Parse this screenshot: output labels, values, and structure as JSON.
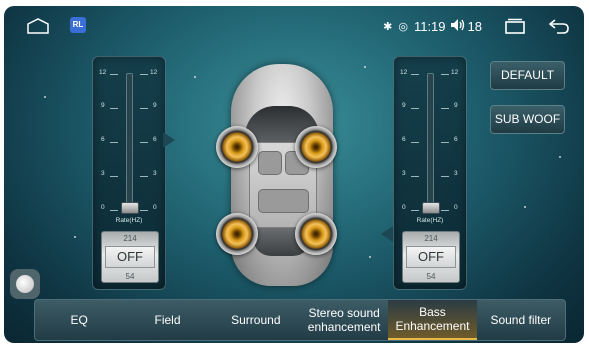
{
  "status_bar": {
    "app_icon_text": "RL",
    "time": "11:19",
    "volume": "18"
  },
  "left_panel": {
    "scale": [
      "12",
      "9",
      "6",
      "3",
      "0"
    ],
    "rate_label": "Rate(HZ)",
    "spinner_prev": "214",
    "spinner_value": "OFF",
    "spinner_next": "54",
    "slider_level": 0
  },
  "right_panel": {
    "scale": [
      "12",
      "9",
      "6",
      "3",
      "0"
    ],
    "rate_label": "Rate(HZ)",
    "spinner_prev": "214",
    "spinner_value": "OFF",
    "spinner_next": "54",
    "slider_level": 0
  },
  "buttons": {
    "default": "DEFAULT",
    "subwoof": "SUB WOOF"
  },
  "tabs": [
    {
      "label": "EQ",
      "active": false
    },
    {
      "label": "Field",
      "active": false
    },
    {
      "label": "Surround",
      "active": false
    },
    {
      "label": "Stereo sound\nenhancement",
      "active": false
    },
    {
      "label": "Bass\nEnhancement",
      "active": true
    },
    {
      "label": "Sound filter",
      "active": false
    }
  ],
  "colors": {
    "accent": "#e8b84a",
    "background": "#1d5d6c"
  }
}
